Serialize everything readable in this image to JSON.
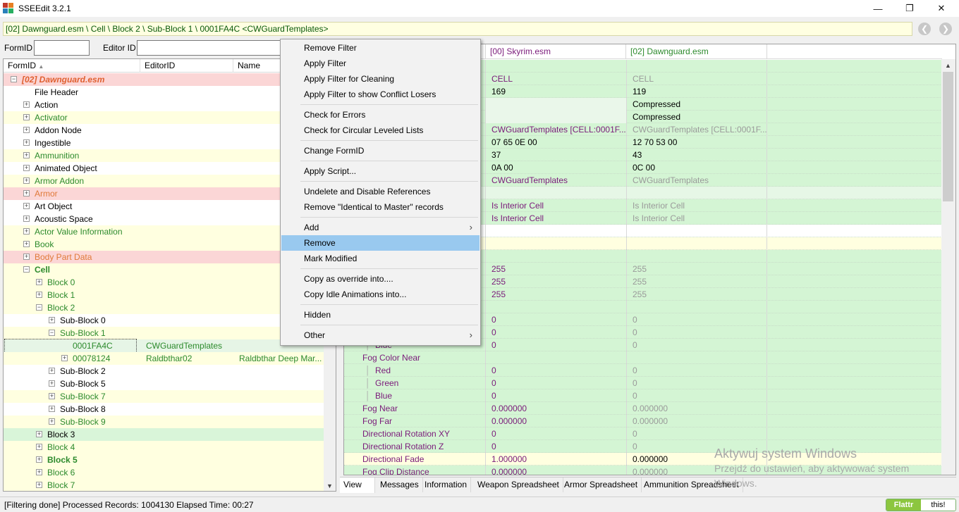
{
  "window": {
    "title": "SSEEdit 3.2.1",
    "minimize": "—",
    "maximize": "❐",
    "close": "✕"
  },
  "path_bar": {
    "text": "[02] Dawnguard.esm \\ Cell \\ Block 2 \\ Sub-Block 1 \\ 0001FA4C <CWGuardTemplates>"
  },
  "filter": {
    "formid_label": "FormID",
    "formid_value": "",
    "editorid_label": "Editor ID",
    "editorid_value": ""
  },
  "tree": {
    "columns": [
      "FormID",
      "EditorID",
      "Name"
    ],
    "rows": [
      {
        "label": "[02] Dawnguard.esm",
        "level": 0,
        "exp": "-",
        "color": "#e06030",
        "bg": "#fbd6d6",
        "italic": true,
        "bold": true
      },
      {
        "label": "File Header",
        "level": 1,
        "exp": "",
        "color": "#000000",
        "bg": "#ffffff"
      },
      {
        "label": "Action",
        "level": 1,
        "exp": "+",
        "color": "#000000",
        "bg": "#ffffff"
      },
      {
        "label": "Activator",
        "level": 1,
        "exp": "+",
        "color": "#2c8a2c",
        "bg": "#ffffe0"
      },
      {
        "label": "Addon Node",
        "level": 1,
        "exp": "+",
        "color": "#000000",
        "bg": "#ffffff"
      },
      {
        "label": "Ingestible",
        "level": 1,
        "exp": "+",
        "color": "#000000",
        "bg": "#ffffff"
      },
      {
        "label": "Ammunition",
        "level": 1,
        "exp": "+",
        "color": "#2c8a2c",
        "bg": "#ffffe0"
      },
      {
        "label": "Animated Object",
        "level": 1,
        "exp": "+",
        "color": "#000000",
        "bg": "#ffffff"
      },
      {
        "label": "Armor Addon",
        "level": 1,
        "exp": "+",
        "color": "#2c8a2c",
        "bg": "#ffffe0"
      },
      {
        "label": "Armor",
        "level": 1,
        "exp": "+",
        "color": "#e07a3a",
        "bg": "#fbd6d6"
      },
      {
        "label": "Art Object",
        "level": 1,
        "exp": "+",
        "color": "#000000",
        "bg": "#ffffff"
      },
      {
        "label": "Acoustic Space",
        "level": 1,
        "exp": "+",
        "color": "#000000",
        "bg": "#ffffff"
      },
      {
        "label": "Actor Value Information",
        "level": 1,
        "exp": "+",
        "color": "#2c8a2c",
        "bg": "#ffffe0"
      },
      {
        "label": "Book",
        "level": 1,
        "exp": "+",
        "color": "#2c8a2c",
        "bg": "#ffffe0"
      },
      {
        "label": "Body Part Data",
        "level": 1,
        "exp": "+",
        "color": "#e07a3a",
        "bg": "#fbd6d6"
      },
      {
        "label": "Cell",
        "level": 1,
        "exp": "-",
        "color": "#2c8a2c",
        "bg": "#ffffe0",
        "bold": true
      },
      {
        "label": "Block 0",
        "level": 2,
        "exp": "+",
        "color": "#2c8a2c",
        "bg": "#ffffe0"
      },
      {
        "label": "Block 1",
        "level": 2,
        "exp": "+",
        "color": "#2c8a2c",
        "bg": "#ffffe0"
      },
      {
        "label": "Block 2",
        "level": 2,
        "exp": "-",
        "color": "#2c8a2c",
        "bg": "#ffffe0"
      },
      {
        "label": "Sub-Block 0",
        "level": 3,
        "exp": "+",
        "color": "#000000",
        "bg": "#ffffff"
      },
      {
        "label": "Sub-Block 1",
        "level": 3,
        "exp": "-",
        "color": "#2c8a2c",
        "bg": "#ffffe0"
      },
      {
        "label": "0001FA4C",
        "level": 4,
        "exp": "",
        "color": "#2c8a2c",
        "bg": "#e6f5e6",
        "editor": "CWGuardTemplates",
        "name": "",
        "selected": true
      },
      {
        "label": "00078124",
        "level": 4,
        "exp": "+",
        "color": "#2c8a2c",
        "bg": "#ffffe0",
        "editor": "Raldbthar02",
        "name": "Raldbthar Deep Mar..."
      },
      {
        "label": "Sub-Block 2",
        "level": 3,
        "exp": "+",
        "color": "#000000",
        "bg": "#ffffff"
      },
      {
        "label": "Sub-Block 5",
        "level": 3,
        "exp": "+",
        "color": "#000000",
        "bg": "#ffffff"
      },
      {
        "label": "Sub-Block 7",
        "level": 3,
        "exp": "+",
        "color": "#2c8a2c",
        "bg": "#ffffe0"
      },
      {
        "label": "Sub-Block 8",
        "level": 3,
        "exp": "+",
        "color": "#000000",
        "bg": "#ffffff"
      },
      {
        "label": "Sub-Block 9",
        "level": 3,
        "exp": "+",
        "color": "#2c8a2c",
        "bg": "#ffffe0"
      },
      {
        "label": "Block 3",
        "level": 2,
        "exp": "+",
        "color": "#000000",
        "bg": "#d9f5d9"
      },
      {
        "label": "Block 4",
        "level": 2,
        "exp": "+",
        "color": "#2c8a2c",
        "bg": "#ffffe0"
      },
      {
        "label": "Block 5",
        "level": 2,
        "exp": "+",
        "color": "#2c8a2c",
        "bg": "#ffffe0",
        "bold": true
      },
      {
        "label": "Block 6",
        "level": 2,
        "exp": "+",
        "color": "#2c8a2c",
        "bg": "#ffffe0"
      },
      {
        "label": "Block 7",
        "level": 2,
        "exp": "+",
        "color": "#2c8a2c",
        "bg": "#ffffe0"
      }
    ]
  },
  "record_view": {
    "headers": [
      "[00] Skyrim.esm",
      "[02] Dawnguard.esm"
    ],
    "rows": [
      {
        "label": "",
        "v0": "",
        "v1": "",
        "bg": "#d4f5d4"
      },
      {
        "label": "",
        "v0": "CELL",
        "v1": "CELL",
        "bg": "#d4f5d4",
        "c0": "#7a1a7a",
        "c1": "#9a9a9a"
      },
      {
        "label": "",
        "v0": "169",
        "v1": "119",
        "bg": "#d4f5d4",
        "c0": "#000000",
        "c1": "#000000"
      },
      {
        "label": "",
        "v0": "",
        "v1": "Compressed",
        "bg": "#d4f5d4",
        "c0": "#000000",
        "c1": "#000000",
        "v0bg": "#eaf7ea"
      },
      {
        "label": "",
        "v0": "",
        "v1": "Compressed",
        "bg": "#d4f5d4",
        "c0": "#000000",
        "c1": "#000000",
        "v0bg": "#eaf7ea"
      },
      {
        "label": "",
        "v0": "CWGuardTemplates [CELL:0001F...",
        "v1": "CWGuardTemplates [CELL:0001F...",
        "bg": "#d4f5d4",
        "c0": "#7a1a7a",
        "c1": "#9a9a9a"
      },
      {
        "label": "",
        "v0": "07 65 0E 00",
        "v1": "12 70 53 00",
        "bg": "#d4f5d4",
        "c0": "#000000",
        "c1": "#000000"
      },
      {
        "label": "",
        "v0": "37",
        "v1": "43",
        "bg": "#d4f5d4",
        "c0": "#000000",
        "c1": "#000000"
      },
      {
        "label": "",
        "v0": "0A 00",
        "v1": "0C 00",
        "bg": "#d4f5d4",
        "c0": "#000000",
        "c1": "#000000"
      },
      {
        "label": "",
        "v0": "CWGuardTemplates",
        "v1": "CWGuardTemplates",
        "bg": "#d4f5d4",
        "c0": "#7a1a7a",
        "c1": "#9a9a9a"
      },
      {
        "label": "",
        "v0": "",
        "v1": "",
        "bg": "#e6f7e6"
      },
      {
        "label": "",
        "v0": "Is Interior Cell",
        "v1": "Is Interior Cell",
        "bg": "#d4f5d4",
        "c0": "#7a1a7a",
        "c1": "#9a9a9a"
      },
      {
        "label": "",
        "v0": "Is Interior Cell",
        "v1": "Is Interior Cell",
        "bg": "#d4f5d4",
        "c0": "#7a1a7a",
        "c1": "#9a9a9a"
      },
      {
        "label": "",
        "v0": "",
        "v1": "",
        "bg": "#ffffff"
      },
      {
        "label": "",
        "v0": "",
        "v1": "",
        "bg": "#ffffe0"
      },
      {
        "label": "",
        "v0": "",
        "v1": "",
        "bg": "#d4f5d4"
      },
      {
        "label": "",
        "v0": "255",
        "v1": "255",
        "bg": "#d4f5d4",
        "c0": "#7a1a7a",
        "c1": "#9a9a9a"
      },
      {
        "label": "",
        "v0": "255",
        "v1": "255",
        "bg": "#d4f5d4",
        "c0": "#7a1a7a",
        "c1": "#9a9a9a"
      },
      {
        "label": "",
        "v0": "255",
        "v1": "255",
        "bg": "#d4f5d4",
        "c0": "#7a1a7a",
        "c1": "#9a9a9a"
      },
      {
        "label": "",
        "v0": "",
        "v1": "",
        "bg": "#d4f5d4"
      },
      {
        "label": "",
        "v0": "0",
        "v1": "0",
        "bg": "#d4f5d4",
        "c0": "#7a1a7a",
        "c1": "#9a9a9a"
      },
      {
        "label": "",
        "v0": "0",
        "v1": "0",
        "bg": "#d4f5d4",
        "c0": "#7a1a7a",
        "c1": "#9a9a9a"
      },
      {
        "label": "Blue",
        "v0": "0",
        "v1": "0",
        "bg": "#d4f5d4",
        "c0": "#7a1a7a",
        "c1": "#9a9a9a",
        "lv": 2
      },
      {
        "label": "Fog Color Near",
        "v0": "",
        "v1": "",
        "bg": "#d4f5d4",
        "lv": 1
      },
      {
        "label": "Red",
        "v0": "0",
        "v1": "0",
        "bg": "#d4f5d4",
        "c0": "#7a1a7a",
        "c1": "#9a9a9a",
        "lv": 2
      },
      {
        "label": "Green",
        "v0": "0",
        "v1": "0",
        "bg": "#d4f5d4",
        "c0": "#7a1a7a",
        "c1": "#9a9a9a",
        "lv": 2
      },
      {
        "label": "Blue",
        "v0": "0",
        "v1": "0",
        "bg": "#d4f5d4",
        "c0": "#7a1a7a",
        "c1": "#9a9a9a",
        "lv": 2
      },
      {
        "label": "Fog Near",
        "v0": "0.000000",
        "v1": "0.000000",
        "bg": "#d4f5d4",
        "c0": "#7a1a7a",
        "c1": "#9a9a9a",
        "lv": 1
      },
      {
        "label": "Fog Far",
        "v0": "0.000000",
        "v1": "0.000000",
        "bg": "#d4f5d4",
        "c0": "#7a1a7a",
        "c1": "#9a9a9a",
        "lv": 1
      },
      {
        "label": "Directional Rotation XY",
        "v0": "0",
        "v1": "0",
        "bg": "#d4f5d4",
        "c0": "#7a1a7a",
        "c1": "#9a9a9a",
        "lv": 1
      },
      {
        "label": "Directional Rotation Z",
        "v0": "0",
        "v1": "0",
        "bg": "#d4f5d4",
        "c0": "#7a1a7a",
        "c1": "#9a9a9a",
        "lv": 1
      },
      {
        "label": "Directional Fade",
        "v0": "1.000000",
        "v1": "0.000000",
        "bg": "#ffffe0",
        "c0": "#7a1a7a",
        "c1": "#000000",
        "lv": 1
      },
      {
        "label": "Fog Clip Distance",
        "v0": "0.000000",
        "v1": "0.000000",
        "bg": "#d4f5d4",
        "c0": "#7a1a7a",
        "c1": "#9a9a9a",
        "lv": 1
      }
    ]
  },
  "tabs": [
    "View",
    "Messages",
    "Information",
    "Weapon Spreadsheet",
    "Armor Spreadsheet",
    "Ammunition Spreadsheet"
  ],
  "context_menu": {
    "items": [
      {
        "label": "Remove Filter"
      },
      {
        "label": "Apply Filter"
      },
      {
        "label": "Apply Filter for Cleaning"
      },
      {
        "label": "Apply Filter to show Conflict Losers"
      },
      {
        "sep": true
      },
      {
        "label": "Check for Errors"
      },
      {
        "label": "Check for Circular Leveled Lists"
      },
      {
        "sep": true
      },
      {
        "label": "Change FormID"
      },
      {
        "sep": true
      },
      {
        "label": "Apply Script..."
      },
      {
        "sep": true
      },
      {
        "label": "Undelete and Disable References"
      },
      {
        "label": "Remove \"Identical to Master\" records"
      },
      {
        "sep": true
      },
      {
        "label": "Add",
        "sub": true
      },
      {
        "label": "Remove",
        "highlight": true
      },
      {
        "label": "Mark Modified"
      },
      {
        "sep": true
      },
      {
        "label": "Copy as override into...."
      },
      {
        "label": "Copy Idle Animations into..."
      },
      {
        "sep": true
      },
      {
        "label": "Hidden"
      },
      {
        "sep": true
      },
      {
        "label": "Other",
        "sub": true
      }
    ]
  },
  "status": {
    "text": "[Filtering done]  Processed Records: 1004130 Elapsed Time: 00:27",
    "flattr": "Flattr",
    "this": "this!"
  },
  "watermark": {
    "line1": "Aktywuj system Windows",
    "line2": "Przejdź do ustawień, aby aktywować system",
    "line3": "Windows."
  },
  "colors": {
    "menu_highlight": "#99c9ef",
    "path_bg": "#ffffe1"
  }
}
